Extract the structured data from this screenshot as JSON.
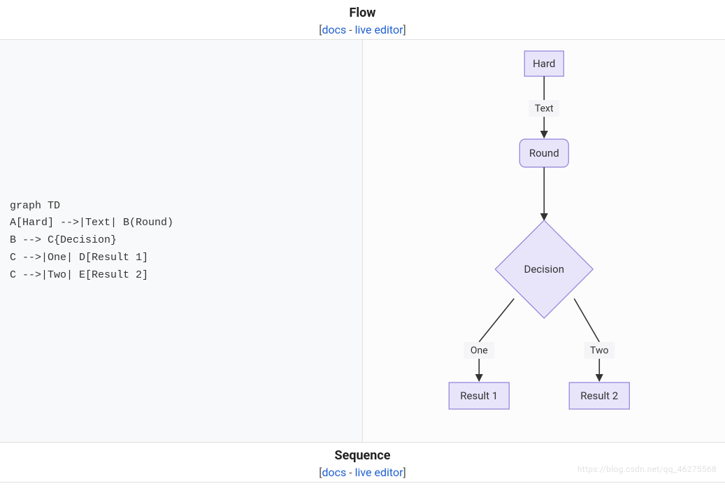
{
  "sections": [
    {
      "title": "Flow",
      "bracket_open": "[",
      "docs": "docs",
      "sep": " - ",
      "live_editor": "live editor",
      "bracket_close": "]"
    },
    {
      "title": "Sequence",
      "bracket_open": "[",
      "docs": "docs",
      "sep": " - ",
      "live_editor": "live editor",
      "bracket_close": "]"
    }
  ],
  "code": "graph TD\nA[Hard] -->|Text| B(Round)\nB --> C{Decision}\nC -->|One| D[Result 1]\nC -->|Two| E[Result 2]",
  "diagram": {
    "nodes": {
      "A": {
        "label": "Hard",
        "shape": "rect"
      },
      "B": {
        "label": "Round",
        "shape": "round"
      },
      "C": {
        "label": "Decision",
        "shape": "diamond"
      },
      "D": {
        "label": "Result 1",
        "shape": "rect"
      },
      "E": {
        "label": "Result 2",
        "shape": "rect"
      }
    },
    "edges": [
      {
        "from": "A",
        "to": "B",
        "label": "Text"
      },
      {
        "from": "B",
        "to": "C",
        "label": ""
      },
      {
        "from": "C",
        "to": "D",
        "label": "One"
      },
      {
        "from": "C",
        "to": "E",
        "label": "Two"
      }
    ]
  },
  "watermark": "https://blog.csdn.net/qq_46275568"
}
